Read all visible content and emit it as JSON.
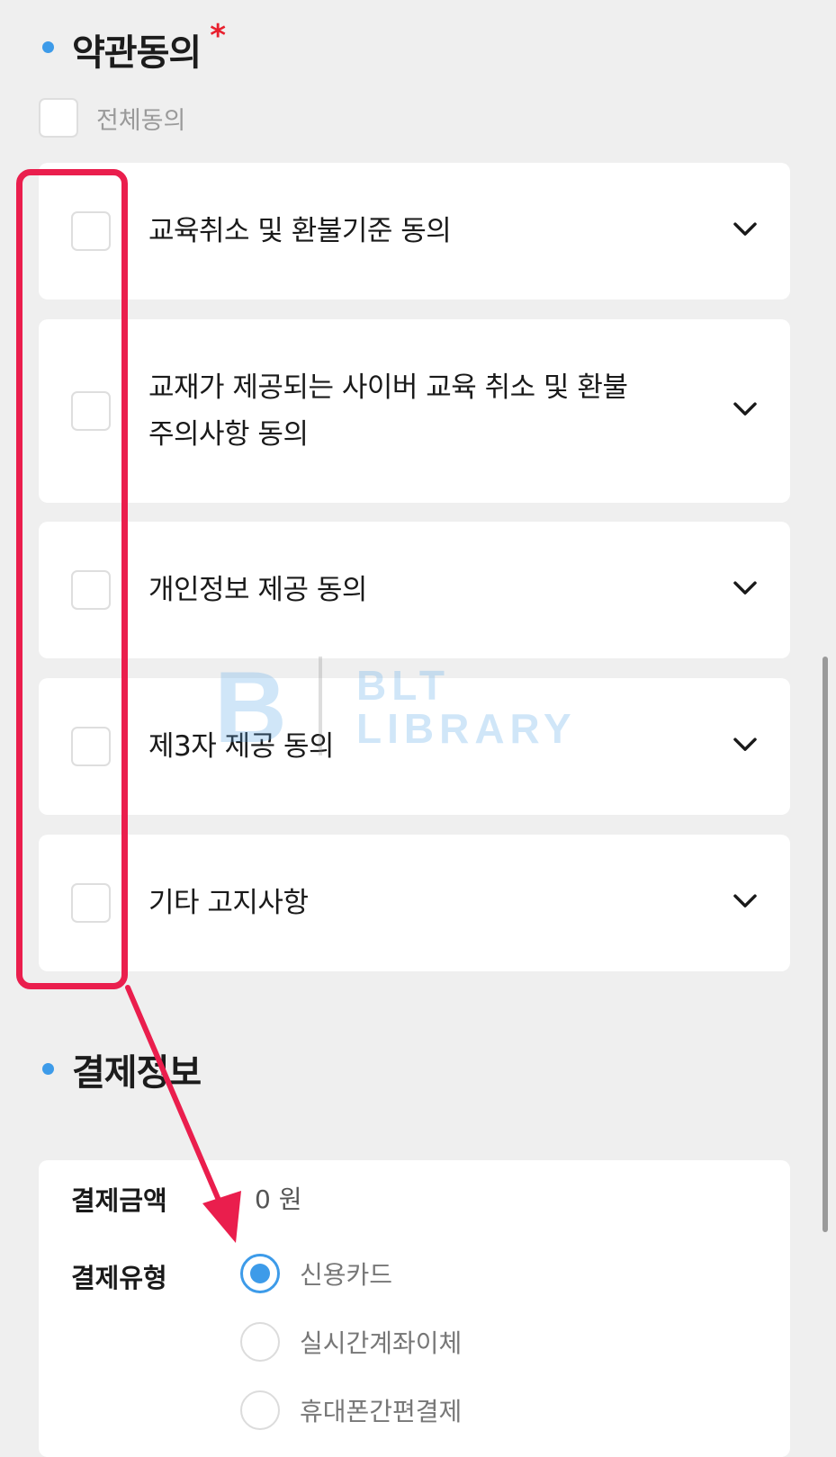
{
  "terms_section": {
    "title": "약관동의",
    "required_mark": "*",
    "all_agree_label": "전체동의",
    "items": [
      {
        "label": "교육취소 및 환불기준 동의",
        "checked": false
      },
      {
        "label": "교재가 제공되는 사이버 교육 취소 및 환불 주의사항 동의",
        "checked": false
      },
      {
        "label": "개인정보 제공 동의",
        "checked": false
      },
      {
        "label": "제3자 제공 동의",
        "checked": false
      },
      {
        "label": "기타 고지사항",
        "checked": false
      }
    ],
    "expand_icon": "chevron-down-icon"
  },
  "payment_section": {
    "title": "결제정보",
    "amount_label": "결제금액",
    "amount_value": "0 원",
    "type_label": "결제유형",
    "options": [
      {
        "label": "신용카드",
        "selected": true
      },
      {
        "label": "실시간계좌이체",
        "selected": false
      },
      {
        "label": "휴대폰간편결제",
        "selected": false
      }
    ]
  },
  "watermark": {
    "letter": "B",
    "line1": "BLT",
    "line2": "LIBRARY"
  },
  "colors": {
    "accent": "#3d9be9",
    "highlight": "#ea1e4d",
    "required": "#e8202e",
    "background": "#efefef"
  }
}
